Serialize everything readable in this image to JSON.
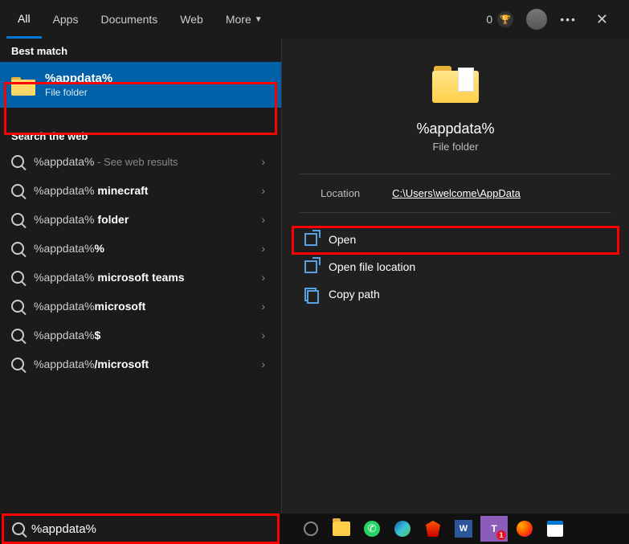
{
  "tabs": {
    "all": "All",
    "apps": "Apps",
    "documents": "Documents",
    "web": "Web",
    "more": "More"
  },
  "top": {
    "points": "0"
  },
  "left": {
    "best_match_label": "Best match",
    "best_match": {
      "title": "%appdata%",
      "subtitle": "File folder"
    },
    "search_web_label": "Search the web",
    "web_items": [
      {
        "prefix": "%appdata%",
        "bold": "",
        "suffix": " - See web results"
      },
      {
        "prefix": "%appdata% ",
        "bold": "minecraft",
        "suffix": ""
      },
      {
        "prefix": "%appdata% ",
        "bold": "folder",
        "suffix": ""
      },
      {
        "prefix": "%appdata%",
        "bold": "%",
        "suffix": ""
      },
      {
        "prefix": "%appdata% ",
        "bold": "microsoft teams",
        "suffix": ""
      },
      {
        "prefix": "%appdata%",
        "bold": "microsoft",
        "suffix": ""
      },
      {
        "prefix": "%appdata%",
        "bold": "$",
        "suffix": ""
      },
      {
        "prefix": "%appdata%",
        "bold": "/microsoft",
        "suffix": ""
      }
    ]
  },
  "preview": {
    "title": "%appdata%",
    "subtitle": "File folder",
    "location_label": "Location",
    "location_value": "C:\\Users\\welcome\\AppData",
    "actions": {
      "open": "Open",
      "open_loc": "Open file location",
      "copy": "Copy path"
    }
  },
  "search": {
    "value": "%appdata%"
  },
  "taskbar": {
    "teams_badge": "1"
  }
}
